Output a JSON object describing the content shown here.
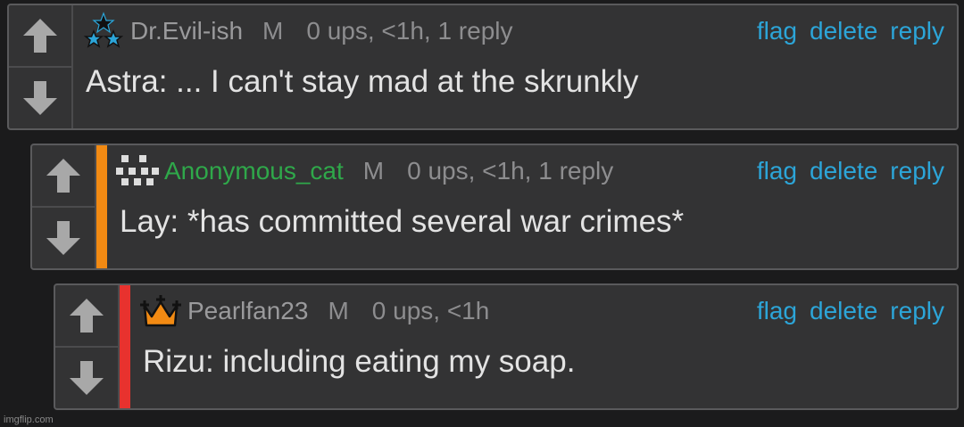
{
  "comments": [
    {
      "username": "Dr.Evil-ish",
      "badge": "M",
      "stats": "0 ups, <1h, 1 reply",
      "text": "Astra: ... I can't stay mad at the skrunkly",
      "avatar_icon": "stars-icon",
      "thread_color": ""
    },
    {
      "username": "Anonymous_cat",
      "badge": "M",
      "stats": "0 ups, <1h, 1 reply",
      "text": "Lay: *has committed several war crimes*",
      "avatar_icon": "pixel-face-icon",
      "thread_color": "#f28a13"
    },
    {
      "username": "Pearlfan23",
      "badge": "M",
      "stats": "0 ups, <1h",
      "text": "Rizu: including eating my soap.",
      "avatar_icon": "crown-icon",
      "thread_color": "#e8322e"
    }
  ],
  "actions": {
    "flag": "flag",
    "delete": "delete",
    "reply": "reply"
  },
  "colors": {
    "link": "#2ca5d8",
    "username_green": "#2fa84a",
    "panel": "#333334",
    "background": "#1b1b1c"
  },
  "watermark": "imgflip.com"
}
